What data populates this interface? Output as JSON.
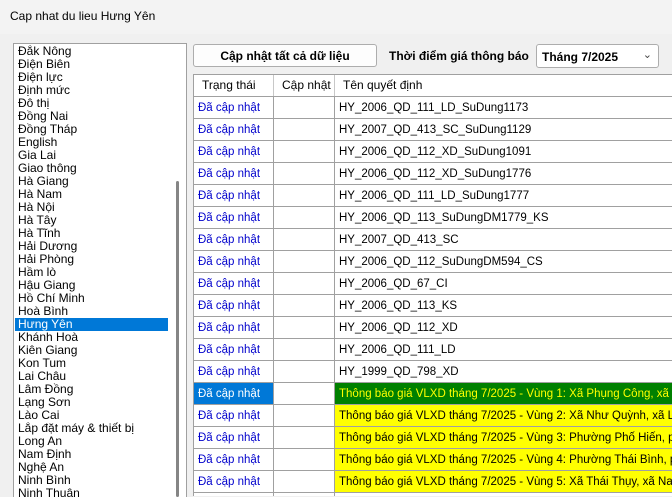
{
  "window": {
    "title": "Cap nhat du lieu Hưng Yên"
  },
  "left_list": {
    "items": [
      "Đắk Nông",
      "Điện Biên",
      "Điện lực",
      "Định mức",
      "Đô thị",
      "Đồng Nai",
      "Đồng Tháp",
      "English",
      "Gia Lai",
      "Giao thông",
      "Hà Giang",
      "Hà Nam",
      "Hà Nội",
      "Hà Tây",
      "Hà Tĩnh",
      "Hải Dương",
      "Hải Phòng",
      "Hầm lò",
      "Hậu Giang",
      "Hồ Chí Minh",
      "Hoà Bình",
      "Hưng Yên",
      "Khánh Hoà",
      "Kiên Giang",
      "Kon Tum",
      "Lai Châu",
      "Lâm Đồng",
      "Lạng Sơn",
      "Lào Cai",
      "Lắp đặt máy & thiết bị",
      "Long An",
      "Nam Định",
      "Nghệ An",
      "Ninh Bình",
      "Ninh Thuận"
    ],
    "selected_index": 21
  },
  "toolbar": {
    "update_all_label": "Cập nhật tất cả dữ liệu",
    "time_label": "Thời điểm giá thông báo",
    "period_value": "Tháng 7/2025"
  },
  "grid": {
    "columns": [
      "Trạng thái",
      "Cập nhật",
      "Tên quyết định"
    ],
    "rows": [
      {
        "status": "Đã cập nhật",
        "update": "",
        "name": "HY_2006_QD_111_LD_SuDung1173"
      },
      {
        "status": "Đã cập nhật",
        "update": "",
        "name": "HY_2007_QD_413_SC_SuDung1129"
      },
      {
        "status": "Đã cập nhật",
        "update": "",
        "name": "HY_2006_QD_112_XD_SuDung1091"
      },
      {
        "status": "Đã cập nhật",
        "update": "",
        "name": "HY_2006_QD_112_XD_SuDung1776"
      },
      {
        "status": "Đã cập nhật",
        "update": "",
        "name": "HY_2006_QD_111_LD_SuDung1777"
      },
      {
        "status": "Đã cập nhật",
        "update": "",
        "name": "HY_2006_QD_113_SuDungDM1779_KS"
      },
      {
        "status": "Đã cập nhật",
        "update": "",
        "name": "HY_2007_QD_413_SC"
      },
      {
        "status": "Đã cập nhật",
        "update": "",
        "name": "HY_2006_QD_112_SuDungDM594_CS"
      },
      {
        "status": "Đã cập nhật",
        "update": "",
        "name": "HY_2006_QD_67_CI"
      },
      {
        "status": "Đã cập nhật",
        "update": "",
        "name": "HY_2006_QD_113_KS"
      },
      {
        "status": "Đã cập nhật",
        "update": "",
        "name": "HY_2006_QD_112_XD"
      },
      {
        "status": "Đã cập nhật",
        "update": "",
        "name": "HY_2006_QD_111_LD"
      },
      {
        "status": "Đã cập nhật",
        "update": "",
        "name": "HY_1999_QD_798_XD"
      },
      {
        "status": "Đã cập nhật",
        "update": "",
        "name": "Thông báo giá VLXD tháng 7/2025 - Vùng 1: Xã Phụng Công, xã Văn"
      },
      {
        "status": "Đã cập nhật",
        "update": "",
        "name": "Thông báo giá VLXD tháng 7/2025 - Vùng 2: Xã Như Quỳnh, xã Lạc Đ"
      },
      {
        "status": "Đã cập nhật",
        "update": "",
        "name": "Thông báo giá VLXD tháng 7/2025 - Vùng 3: Phường Phố Hiến, phườ"
      },
      {
        "status": "Đã cập nhật",
        "update": "",
        "name": "Thông báo giá VLXD tháng 7/2025 - Vùng 4: Phường Thái Bình, phườ"
      },
      {
        "status": "Đã cập nhật",
        "update": "",
        "name": "Thông báo giá VLXD tháng 7/2025 - Vùng 5: Xã Thái Thụy, xã Nam Th"
      },
      {
        "status": "",
        "update": "",
        "name": ""
      }
    ],
    "highlight_from": 13,
    "selected_row": 13
  }
}
